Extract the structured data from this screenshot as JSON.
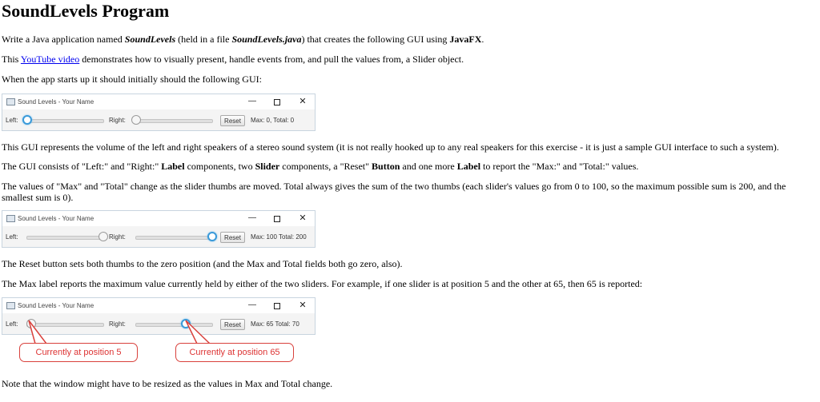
{
  "heading": "SoundLevels Program",
  "p1": {
    "t1": "Write a Java application named ",
    "t2": "SoundLevels",
    "t3": " (held in a file ",
    "t4": "SoundLevels.java",
    "t5": ") that creates the following GUI using ",
    "t6": "JavaFX",
    "t7": "."
  },
  "p2": {
    "t1": "This ",
    "link": "YouTube video",
    "t2": " demonstrates how to visually present, handle events from, and pull the values from, a Slider object."
  },
  "p3": "When the app starts up it should initially should the following GUI:",
  "window": {
    "title": "Sound Levels - Your Name",
    "min": "—",
    "close": "✕",
    "left_label": "Left:",
    "right_label": "Right:",
    "reset_label": "Reset"
  },
  "win1": {
    "left_value": 0,
    "right_value": 0,
    "status": "Max:  0, Total:  0"
  },
  "p4": "This GUI represents the volume of the left and right speakers of a stereo sound system (it is not really hooked up to any real speakers for this exercise - it is just a sample GUI interface to such a system).",
  "p5": {
    "t1": "The GUI consists of \"Left:\" and \"Right:\" ",
    "t2": "Label",
    "t3": " components, two ",
    "t4": "Slider",
    "t5": " components, a \"Reset\" ",
    "t6": "Button",
    "t7": " and one more ",
    "t8": "Label",
    "t9": " to report the \"Max:\" and \"Total:\" values."
  },
  "p6": "The values of \"Max\" and \"Total\" change as the slider thumbs are moved. Total always gives the sum of the two thumbs (each slider's values go from 0 to 100, so the maximum possible sum is 200, and the smallest sum is 0).",
  "win2": {
    "left_value": 100,
    "right_value": 100,
    "status": "Max: 100 Total: 200"
  },
  "p7": "The Reset button sets both thumbs to the zero position (and the Max and Total fields both go zero, also).",
  "p8": "The Max label reports the maximum value currently held by either of the two sliders. For example, if one slider is at position 5 and the other at 65, then 65 is reported:",
  "win3": {
    "left_value": 5,
    "right_value": 65,
    "status": "Max: 65 Total: 70"
  },
  "callout_left": "Currently at position 5",
  "callout_right": "Currently at position 65",
  "p9": "Note that the window might have to be resized as the values in Max and Total change.",
  "colors": {
    "focus_ring": "#3a9ad9",
    "callout": "#d9413c",
    "link": "#0000ee"
  }
}
